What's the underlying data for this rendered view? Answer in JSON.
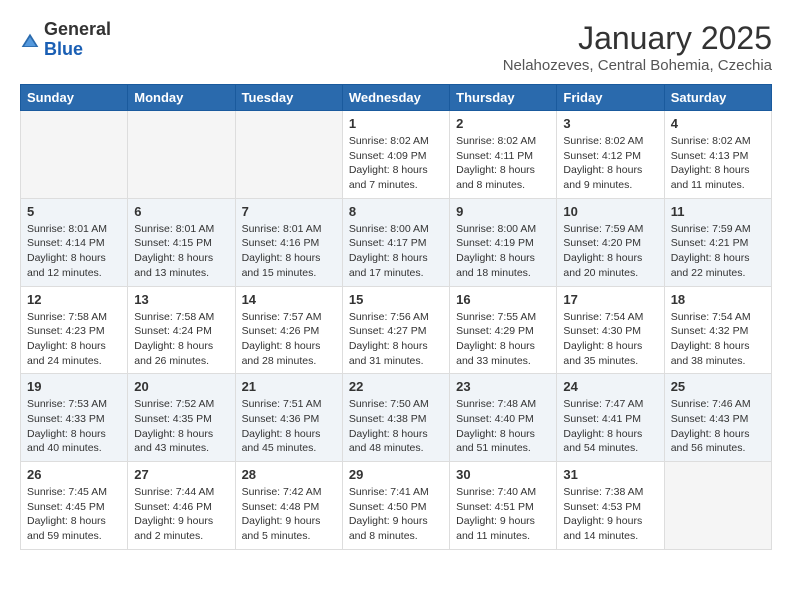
{
  "header": {
    "logo_general": "General",
    "logo_blue": "Blue",
    "month_title": "January 2025",
    "location": "Nelahozeves, Central Bohemia, Czechia"
  },
  "days_of_week": [
    "Sunday",
    "Monday",
    "Tuesday",
    "Wednesday",
    "Thursday",
    "Friday",
    "Saturday"
  ],
  "weeks": [
    [
      {
        "day": "",
        "sunrise": "",
        "sunset": "",
        "daylight": ""
      },
      {
        "day": "",
        "sunrise": "",
        "sunset": "",
        "daylight": ""
      },
      {
        "day": "",
        "sunrise": "",
        "sunset": "",
        "daylight": ""
      },
      {
        "day": "1",
        "sunrise": "Sunrise: 8:02 AM",
        "sunset": "Sunset: 4:09 PM",
        "daylight": "Daylight: 8 hours and 7 minutes."
      },
      {
        "day": "2",
        "sunrise": "Sunrise: 8:02 AM",
        "sunset": "Sunset: 4:11 PM",
        "daylight": "Daylight: 8 hours and 8 minutes."
      },
      {
        "day": "3",
        "sunrise": "Sunrise: 8:02 AM",
        "sunset": "Sunset: 4:12 PM",
        "daylight": "Daylight: 8 hours and 9 minutes."
      },
      {
        "day": "4",
        "sunrise": "Sunrise: 8:02 AM",
        "sunset": "Sunset: 4:13 PM",
        "daylight": "Daylight: 8 hours and 11 minutes."
      }
    ],
    [
      {
        "day": "5",
        "sunrise": "Sunrise: 8:01 AM",
        "sunset": "Sunset: 4:14 PM",
        "daylight": "Daylight: 8 hours and 12 minutes."
      },
      {
        "day": "6",
        "sunrise": "Sunrise: 8:01 AM",
        "sunset": "Sunset: 4:15 PM",
        "daylight": "Daylight: 8 hours and 13 minutes."
      },
      {
        "day": "7",
        "sunrise": "Sunrise: 8:01 AM",
        "sunset": "Sunset: 4:16 PM",
        "daylight": "Daylight: 8 hours and 15 minutes."
      },
      {
        "day": "8",
        "sunrise": "Sunrise: 8:00 AM",
        "sunset": "Sunset: 4:17 PM",
        "daylight": "Daylight: 8 hours and 17 minutes."
      },
      {
        "day": "9",
        "sunrise": "Sunrise: 8:00 AM",
        "sunset": "Sunset: 4:19 PM",
        "daylight": "Daylight: 8 hours and 18 minutes."
      },
      {
        "day": "10",
        "sunrise": "Sunrise: 7:59 AM",
        "sunset": "Sunset: 4:20 PM",
        "daylight": "Daylight: 8 hours and 20 minutes."
      },
      {
        "day": "11",
        "sunrise": "Sunrise: 7:59 AM",
        "sunset": "Sunset: 4:21 PM",
        "daylight": "Daylight: 8 hours and 22 minutes."
      }
    ],
    [
      {
        "day": "12",
        "sunrise": "Sunrise: 7:58 AM",
        "sunset": "Sunset: 4:23 PM",
        "daylight": "Daylight: 8 hours and 24 minutes."
      },
      {
        "day": "13",
        "sunrise": "Sunrise: 7:58 AM",
        "sunset": "Sunset: 4:24 PM",
        "daylight": "Daylight: 8 hours and 26 minutes."
      },
      {
        "day": "14",
        "sunrise": "Sunrise: 7:57 AM",
        "sunset": "Sunset: 4:26 PM",
        "daylight": "Daylight: 8 hours and 28 minutes."
      },
      {
        "day": "15",
        "sunrise": "Sunrise: 7:56 AM",
        "sunset": "Sunset: 4:27 PM",
        "daylight": "Daylight: 8 hours and 31 minutes."
      },
      {
        "day": "16",
        "sunrise": "Sunrise: 7:55 AM",
        "sunset": "Sunset: 4:29 PM",
        "daylight": "Daylight: 8 hours and 33 minutes."
      },
      {
        "day": "17",
        "sunrise": "Sunrise: 7:54 AM",
        "sunset": "Sunset: 4:30 PM",
        "daylight": "Daylight: 8 hours and 35 minutes."
      },
      {
        "day": "18",
        "sunrise": "Sunrise: 7:54 AM",
        "sunset": "Sunset: 4:32 PM",
        "daylight": "Daylight: 8 hours and 38 minutes."
      }
    ],
    [
      {
        "day": "19",
        "sunrise": "Sunrise: 7:53 AM",
        "sunset": "Sunset: 4:33 PM",
        "daylight": "Daylight: 8 hours and 40 minutes."
      },
      {
        "day": "20",
        "sunrise": "Sunrise: 7:52 AM",
        "sunset": "Sunset: 4:35 PM",
        "daylight": "Daylight: 8 hours and 43 minutes."
      },
      {
        "day": "21",
        "sunrise": "Sunrise: 7:51 AM",
        "sunset": "Sunset: 4:36 PM",
        "daylight": "Daylight: 8 hours and 45 minutes."
      },
      {
        "day": "22",
        "sunrise": "Sunrise: 7:50 AM",
        "sunset": "Sunset: 4:38 PM",
        "daylight": "Daylight: 8 hours and 48 minutes."
      },
      {
        "day": "23",
        "sunrise": "Sunrise: 7:48 AM",
        "sunset": "Sunset: 4:40 PM",
        "daylight": "Daylight: 8 hours and 51 minutes."
      },
      {
        "day": "24",
        "sunrise": "Sunrise: 7:47 AM",
        "sunset": "Sunset: 4:41 PM",
        "daylight": "Daylight: 8 hours and 54 minutes."
      },
      {
        "day": "25",
        "sunrise": "Sunrise: 7:46 AM",
        "sunset": "Sunset: 4:43 PM",
        "daylight": "Daylight: 8 hours and 56 minutes."
      }
    ],
    [
      {
        "day": "26",
        "sunrise": "Sunrise: 7:45 AM",
        "sunset": "Sunset: 4:45 PM",
        "daylight": "Daylight: 8 hours and 59 minutes."
      },
      {
        "day": "27",
        "sunrise": "Sunrise: 7:44 AM",
        "sunset": "Sunset: 4:46 PM",
        "daylight": "Daylight: 9 hours and 2 minutes."
      },
      {
        "day": "28",
        "sunrise": "Sunrise: 7:42 AM",
        "sunset": "Sunset: 4:48 PM",
        "daylight": "Daylight: 9 hours and 5 minutes."
      },
      {
        "day": "29",
        "sunrise": "Sunrise: 7:41 AM",
        "sunset": "Sunset: 4:50 PM",
        "daylight": "Daylight: 9 hours and 8 minutes."
      },
      {
        "day": "30",
        "sunrise": "Sunrise: 7:40 AM",
        "sunset": "Sunset: 4:51 PM",
        "daylight": "Daylight: 9 hours and 11 minutes."
      },
      {
        "day": "31",
        "sunrise": "Sunrise: 7:38 AM",
        "sunset": "Sunset: 4:53 PM",
        "daylight": "Daylight: 9 hours and 14 minutes."
      },
      {
        "day": "",
        "sunrise": "",
        "sunset": "",
        "daylight": ""
      }
    ]
  ]
}
